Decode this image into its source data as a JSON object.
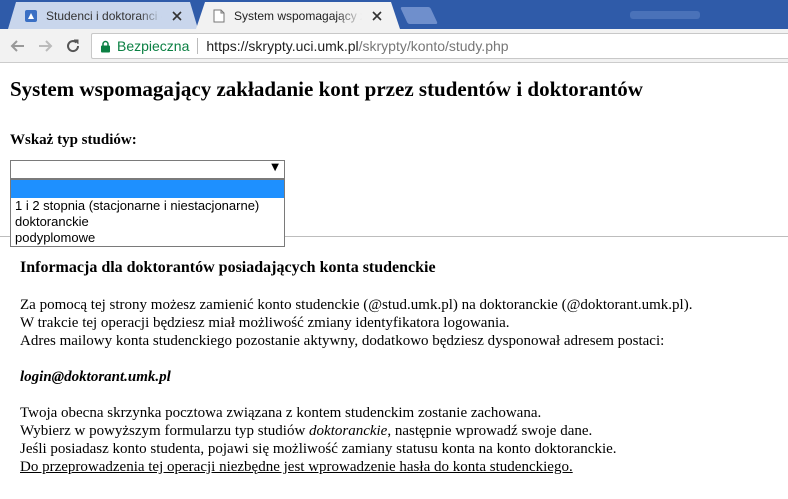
{
  "browser": {
    "tabs": [
      {
        "title": "Studenci i doktoranci - za",
        "active": false
      },
      {
        "title": "System wspomagający za",
        "active": true
      }
    ],
    "secure_label": "Bezpieczna",
    "url_host": "https://skrypty.uci.umk.pl",
    "url_path": "/skrypty/konto/study.php"
  },
  "colors": {
    "tabstrip": "#2f5ba9",
    "secure": "#0b8043",
    "dropdown_highlight": "#1e90ff"
  },
  "page": {
    "title": "System wspomagający zakładanie kont przez studentów i doktorantów",
    "study_label": "Wskaż typ studiów:",
    "select_value": "",
    "options": [
      "",
      "1 i 2 stopnia (stacjonarne i niestacjonarne)",
      "doktoranckie",
      "podyplomowe"
    ]
  },
  "info": {
    "title": "Informacja dla doktorantów posiadających konta studenckie",
    "p1": "Za pomocą tej strony możesz zamienić konto studenckie (@stud.umk.pl) na doktoranckie (@doktorant.umk.pl).",
    "p2": "W trakcie tej operacji będziesz miał możliwość zmiany identyfikatora logowania.",
    "p3": "Adres mailowy konta studenckiego pozostanie aktywny, dodatkowo będziesz dysponował adresem postaci:",
    "login": "login@doktorant.umk.pl",
    "p4": "Twoja obecna skrzynka pocztowa związana z kontem studenckim zostanie zachowana.",
    "p5a": "Wybierz w powyższym formularzu typ studiów ",
    "p5b": "doktoranckie",
    "p5c": ", następnie wprowadź swoje dane.",
    "p6": "Jeśli posiadasz konto studenta, pojawi się możliwość zamiany statusu konta na konto doktoranckie.",
    "p7": "Do przeprowadzenia tej operacji niezbędne jest wprowadzenie hasła do konta studenckiego."
  }
}
